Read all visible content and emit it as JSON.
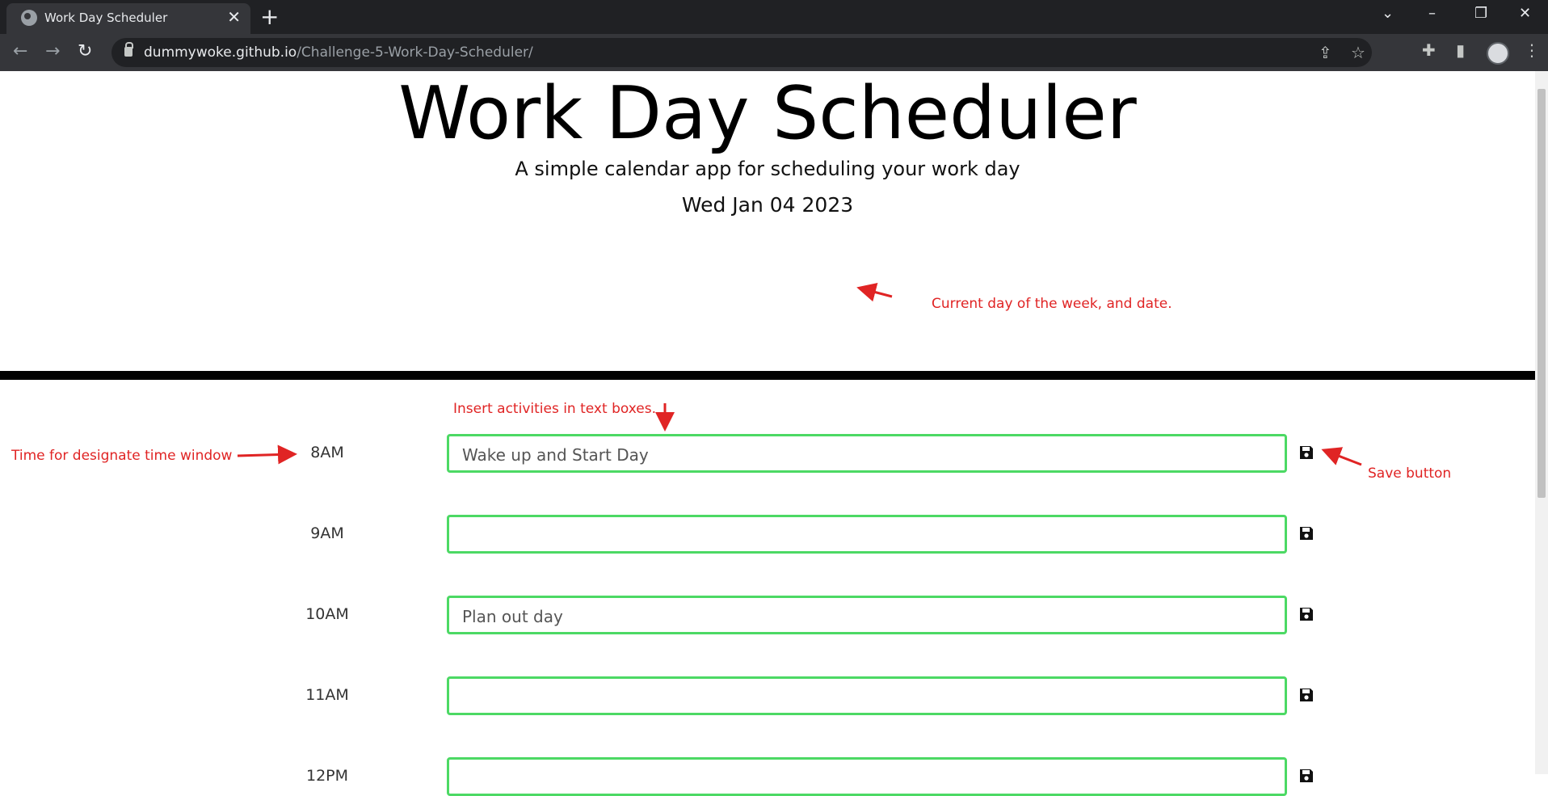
{
  "browser": {
    "tab_title": "Work Day Scheduler",
    "url_host": "dummywoke.github.io",
    "url_path": "/Challenge-5-Work-Day-Scheduler/"
  },
  "header": {
    "title": "Work Day Scheduler",
    "lead": "A simple calendar app for scheduling your work day",
    "current_day": "Wed Jan 04 2023"
  },
  "annotations": {
    "date_note": "Current day of the week, and date.",
    "textbox_note": "Insert activities in text boxes.",
    "time_note": "Time for designate time window",
    "save_note": "Save button"
  },
  "rows": [
    {
      "hour": "8AM",
      "text": "Wake up and Start Day"
    },
    {
      "hour": "9AM",
      "text": ""
    },
    {
      "hour": "10AM",
      "text": "Plan out day"
    },
    {
      "hour": "11AM",
      "text": ""
    },
    {
      "hour": "12PM",
      "text": ""
    }
  ],
  "colors": {
    "annotation": "#e02424",
    "textbox_border": "#4cd964"
  }
}
